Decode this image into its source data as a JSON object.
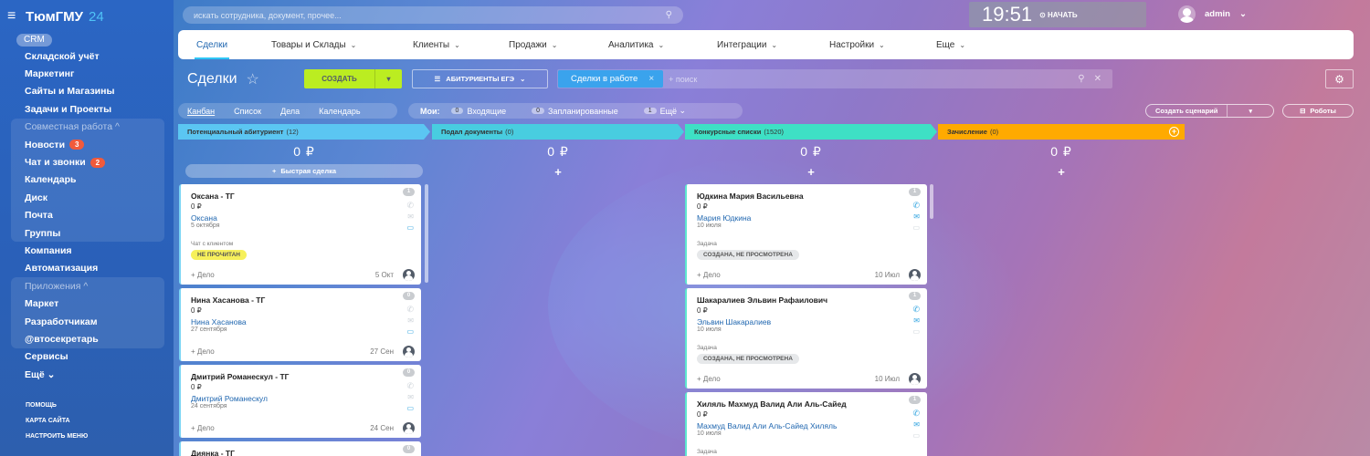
{
  "sidebar": {
    "logo_main": "ТюмГМУ",
    "logo_suffix": "24",
    "crm_badge": "CRM",
    "items_top": [
      "Складской учёт",
      "Маркетинг",
      "Сайты и Магазины",
      "Задачи и Проекты"
    ],
    "group1_head": "Совместная работа",
    "group1": [
      {
        "label": "Новости",
        "count": "3"
      },
      {
        "label": "Чат и звонки",
        "count": "2"
      },
      {
        "label": "Календарь",
        "count": ""
      },
      {
        "label": "Диск",
        "count": ""
      },
      {
        "label": "Почта",
        "count": ""
      },
      {
        "label": "Группы",
        "count": ""
      }
    ],
    "items_mid": [
      "Компания",
      "Автоматизация"
    ],
    "group2_head": "Приложения",
    "group2": [
      "Маркет",
      "Разработчикам",
      "@втосекретарь"
    ],
    "items_bottom": [
      "Сервисы",
      "Ещё"
    ],
    "footer": [
      "ПОМОЩЬ",
      "КАРТА САЙТА",
      "НАСТРОИТЬ МЕНЮ"
    ]
  },
  "topbar": {
    "search_placeholder": "искать сотрудника, документ, прочее...",
    "time": "19:51",
    "start_label": "НАЧАТЬ",
    "user": "admin"
  },
  "nav": {
    "items": [
      {
        "label": "Сделки",
        "dropdown": false
      },
      {
        "label": "Товары и Склады",
        "dropdown": true
      },
      {
        "label": "Клиенты",
        "dropdown": true
      },
      {
        "label": "Продажи",
        "dropdown": true
      },
      {
        "label": "Аналитика",
        "dropdown": true
      },
      {
        "label": "Интеграции",
        "dropdown": true
      },
      {
        "label": "Настройки",
        "dropdown": true
      },
      {
        "label": "Еще",
        "dropdown": true
      }
    ]
  },
  "toolbar": {
    "title": "Сделки",
    "create_label": "СОЗДАТЬ",
    "funnel_label": "АБИТУРИЕНТЫ ЕГЭ",
    "filter_chip": "Сделки в работе",
    "filter_placeholder": "+ поиск"
  },
  "views": {
    "tabs": [
      "Канбан",
      "Список",
      "Дела",
      "Календарь"
    ],
    "mine_label": "Мои:",
    "mine": [
      {
        "count": "0",
        "label": "Входящие"
      },
      {
        "count": "0",
        "label": "Запланированные"
      },
      {
        "count": "1",
        "label": "Ещё"
      }
    ],
    "scenario_label": "Создать сценарий",
    "robots_label": "Роботы"
  },
  "columns": [
    {
      "title": "Потенциальный абитуриент",
      "count": "(12)",
      "sum": "0 ₽",
      "color": "#5bc6f2",
      "quick": "Быстрая сделка"
    },
    {
      "title": "Подал документы",
      "count": "(0)",
      "sum": "0 ₽",
      "color": "#48cde0"
    },
    {
      "title": "Конкурсные списки",
      "count": "(1520)",
      "sum": "0 ₽",
      "color": "#3ee0c5"
    },
    {
      "title": "Зачисление",
      "count": "(0)",
      "sum": "0 ₽",
      "color": "#ffaa00"
    }
  ],
  "cards_col1": [
    {
      "name": "Оксана - ТГ",
      "sum": "0 ₽",
      "contact": "Оксана",
      "date": "5 октября",
      "caption": "Чат с клиентом",
      "badge": "НЕ ПРОЧИТАН",
      "deal": "+ Дело",
      "ddate": "5 Окт",
      "counter": "1"
    },
    {
      "name": "Нина Хасанова - ТГ",
      "sum": "0 ₽",
      "contact": "Нина Хасанова",
      "date": "27 сентября",
      "deal": "+ Дело",
      "ddate": "27 Сен",
      "counter": "0"
    },
    {
      "name": "Дмитрий Романескул - ТГ",
      "sum": "0 ₽",
      "contact": "Дмитрий Романескул",
      "date": "24 сентября",
      "deal": "+ Дело",
      "ddate": "24 Сен",
      "counter": "0"
    },
    {
      "name": "Диянка - ТГ",
      "counter": "0"
    }
  ],
  "cards_col3": [
    {
      "name": "Юдкина Мария Васильевна",
      "sum": "0 ₽",
      "contact": "Мария Юдкина",
      "date": "10 июля",
      "caption": "Задача",
      "badge": "СОЗДАНА, НЕ ПРОСМОТРЕНА",
      "deal": "+ Дело",
      "ddate": "10 Июл",
      "counter": "1"
    },
    {
      "name": "Шакаралиев Эльвин Рафаилович",
      "sum": "0 ₽",
      "contact": "Эльвин Шакаралиев",
      "date": "10 июля",
      "caption": "Задача",
      "badge": "СОЗДАНА, НЕ ПРОСМОТРЕНА",
      "deal": "+ Дело",
      "ddate": "10 Июл",
      "counter": "1"
    },
    {
      "name": "Хиляль Махмуд Валид Али Аль-Сайед",
      "sum": "0 ₽",
      "contact": "Махмуд Валид Али Аль-Сайед Хиляль",
      "date": "10 июля",
      "caption": "Задача",
      "counter": "1"
    }
  ]
}
